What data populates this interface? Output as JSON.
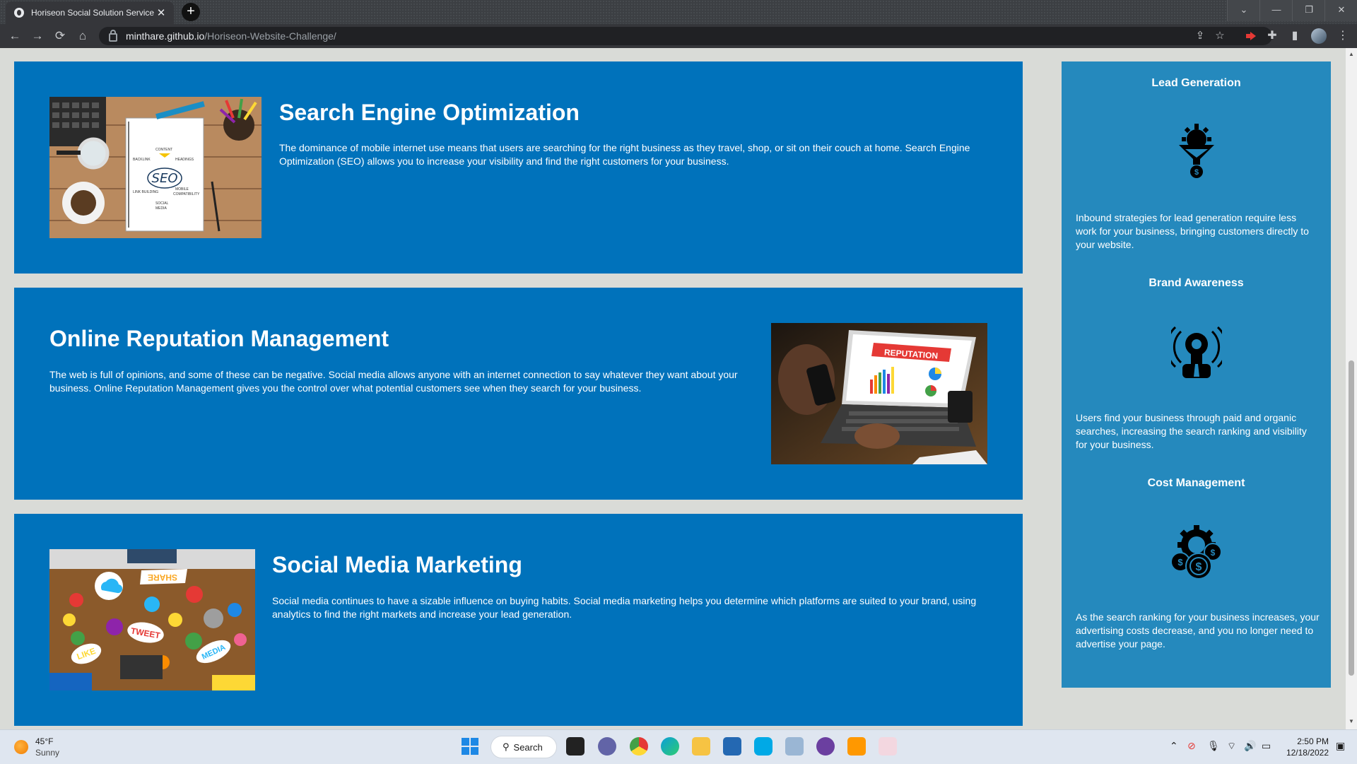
{
  "browser": {
    "tab_title": "Horiseon Social Solution Services",
    "tab_close": "✕",
    "new_tab": "+",
    "url_host": "minthare.github.io",
    "url_path": "/Horiseon-Website-Challenge/",
    "window_controls": {
      "dropdown": "⌄",
      "minimize": "—",
      "restore": "❐",
      "close": "✕"
    },
    "nav": {
      "back": "←",
      "forward": "→",
      "reload": "⟳",
      "home": "⌂"
    }
  },
  "main": {
    "sections": [
      {
        "title": "Search Engine Optimization",
        "body": "The dominance of mobile internet use means that users are searching for the right business as they travel, shop, or sit on their couch at home. Search Engine Optimization (SEO) allows you to increase your visibility and find the right customers for your business.",
        "image_text": {
          "center": "SEO",
          "content": "CONTENT",
          "backlink": "BACKLINK",
          "headings": "HEADINGS",
          "link_building": "LINK BUILDING",
          "mobile": "MOBILE",
          "compatibility": "COMPATIBILITY",
          "social": "SOCIAL",
          "media": "MEDIA"
        }
      },
      {
        "title": "Online Reputation Management",
        "body": "The web is full of opinions, and some of these can be negative. Social media allows anyone with an internet connection to say whatever they want about your business. Online Reputation Management gives you the control over what potential customers see when they search for your business.",
        "image_text": {
          "banner": "REPUTATION"
        }
      },
      {
        "title": "Social Media Marketing",
        "body": "Social media continues to have a sizable influence on buying habits. Social media marketing helps you determine which platforms are suited to your brand, using analytics to find the right markets and increase your lead generation.",
        "image_text": {
          "share": "SHARE",
          "tweet": "TWEET",
          "like": "LIKE",
          "media": "MEDIA"
        }
      }
    ]
  },
  "aside": {
    "benefits": [
      {
        "title": "Lead Generation",
        "icon": "lead-funnel-icon",
        "body": "Inbound strategies for lead generation require less work for your business, bringing customers directly to your website."
      },
      {
        "title": "Brand Awareness",
        "icon": "brand-bulb-icon",
        "body": "Users find your business through paid and organic searches, increasing the search ranking and visibility for your business."
      },
      {
        "title": "Cost Management",
        "icon": "cost-gears-icon",
        "body": "As the search ranking for your business increases, your advertising costs decrease, and you no longer need to advertise your page."
      }
    ]
  },
  "taskbar": {
    "weather_temp": "45°F",
    "weather_condition": "Sunny",
    "search_label": "Search",
    "time": "2:50 PM",
    "date": "12/18/2022"
  },
  "colors": {
    "card_blue": "#0072bb",
    "aside_blue": "#2589bd",
    "page_bg": "#d9dbd7"
  }
}
